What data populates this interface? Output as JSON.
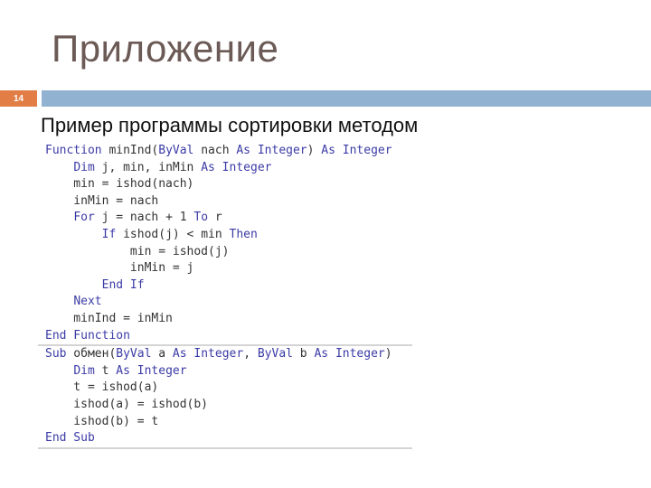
{
  "slide": {
    "title": "Приложение",
    "number": "14",
    "subtitle": "Пример программы сортировки методом",
    "colors": {
      "title_text": "#6b5a55",
      "number_badge": "#e27d46",
      "title_bar": "#92b2d2",
      "keyword": "#3b3ba6",
      "identifier": "#333333"
    }
  },
  "code": {
    "blocks": [
      {
        "name": "function-minInd",
        "lines": [
          [
            {
              "t": "kw",
              "s": "Function"
            },
            {
              "t": "id",
              "s": " minInd("
            },
            {
              "t": "kw",
              "s": "ByVal"
            },
            {
              "t": "id",
              "s": " nach "
            },
            {
              "t": "kw",
              "s": "As Integer"
            },
            {
              "t": "id",
              "s": ") "
            },
            {
              "t": "kw",
              "s": "As Integer"
            }
          ],
          [
            {
              "t": "id",
              "s": "    "
            },
            {
              "t": "kw",
              "s": "Dim"
            },
            {
              "t": "id",
              "s": " j, min, inMin "
            },
            {
              "t": "kw",
              "s": "As Integer"
            }
          ],
          [
            {
              "t": "id",
              "s": "    min = ishod(nach)"
            }
          ],
          [
            {
              "t": "id",
              "s": "    inMin = nach"
            }
          ],
          [
            {
              "t": "id",
              "s": "    "
            },
            {
              "t": "kw",
              "s": "For"
            },
            {
              "t": "id",
              "s": " j = nach + 1 "
            },
            {
              "t": "kw",
              "s": "To"
            },
            {
              "t": "id",
              "s": " r"
            }
          ],
          [
            {
              "t": "id",
              "s": "        "
            },
            {
              "t": "kw",
              "s": "If"
            },
            {
              "t": "id",
              "s": " ishod(j) < min "
            },
            {
              "t": "kw",
              "s": "Then"
            }
          ],
          [
            {
              "t": "id",
              "s": "            min = ishod(j)"
            }
          ],
          [
            {
              "t": "id",
              "s": "            inMin = j"
            }
          ],
          [
            {
              "t": "id",
              "s": "        "
            },
            {
              "t": "kw",
              "s": "End If"
            }
          ],
          [
            {
              "t": "id",
              "s": "    "
            },
            {
              "t": "kw",
              "s": "Next"
            }
          ],
          [
            {
              "t": "id",
              "s": "    minInd = inMin"
            }
          ],
          [
            {
              "t": "kw",
              "s": "End Function"
            }
          ]
        ]
      },
      {
        "name": "sub-obmen",
        "lines": [
          [
            {
              "t": "kw",
              "s": "Sub"
            },
            {
              "t": "id",
              "s": " обмен("
            },
            {
              "t": "kw",
              "s": "ByVal"
            },
            {
              "t": "id",
              "s": " a "
            },
            {
              "t": "kw",
              "s": "As Integer"
            },
            {
              "t": "id",
              "s": ", "
            },
            {
              "t": "kw",
              "s": "ByVal"
            },
            {
              "t": "id",
              "s": " b "
            },
            {
              "t": "kw",
              "s": "As Integer"
            },
            {
              "t": "id",
              "s": ")"
            }
          ],
          [
            {
              "t": "id",
              "s": "    "
            },
            {
              "t": "kw",
              "s": "Dim"
            },
            {
              "t": "id",
              "s": " t "
            },
            {
              "t": "kw",
              "s": "As Integer"
            }
          ],
          [
            {
              "t": "id",
              "s": "    t = ishod(a)"
            }
          ],
          [
            {
              "t": "id",
              "s": "    ishod(a) = ishod(b)"
            }
          ],
          [
            {
              "t": "id",
              "s": "    ishod(b) = t"
            }
          ],
          [
            {
              "t": "kw",
              "s": "End Sub"
            }
          ]
        ]
      }
    ]
  }
}
